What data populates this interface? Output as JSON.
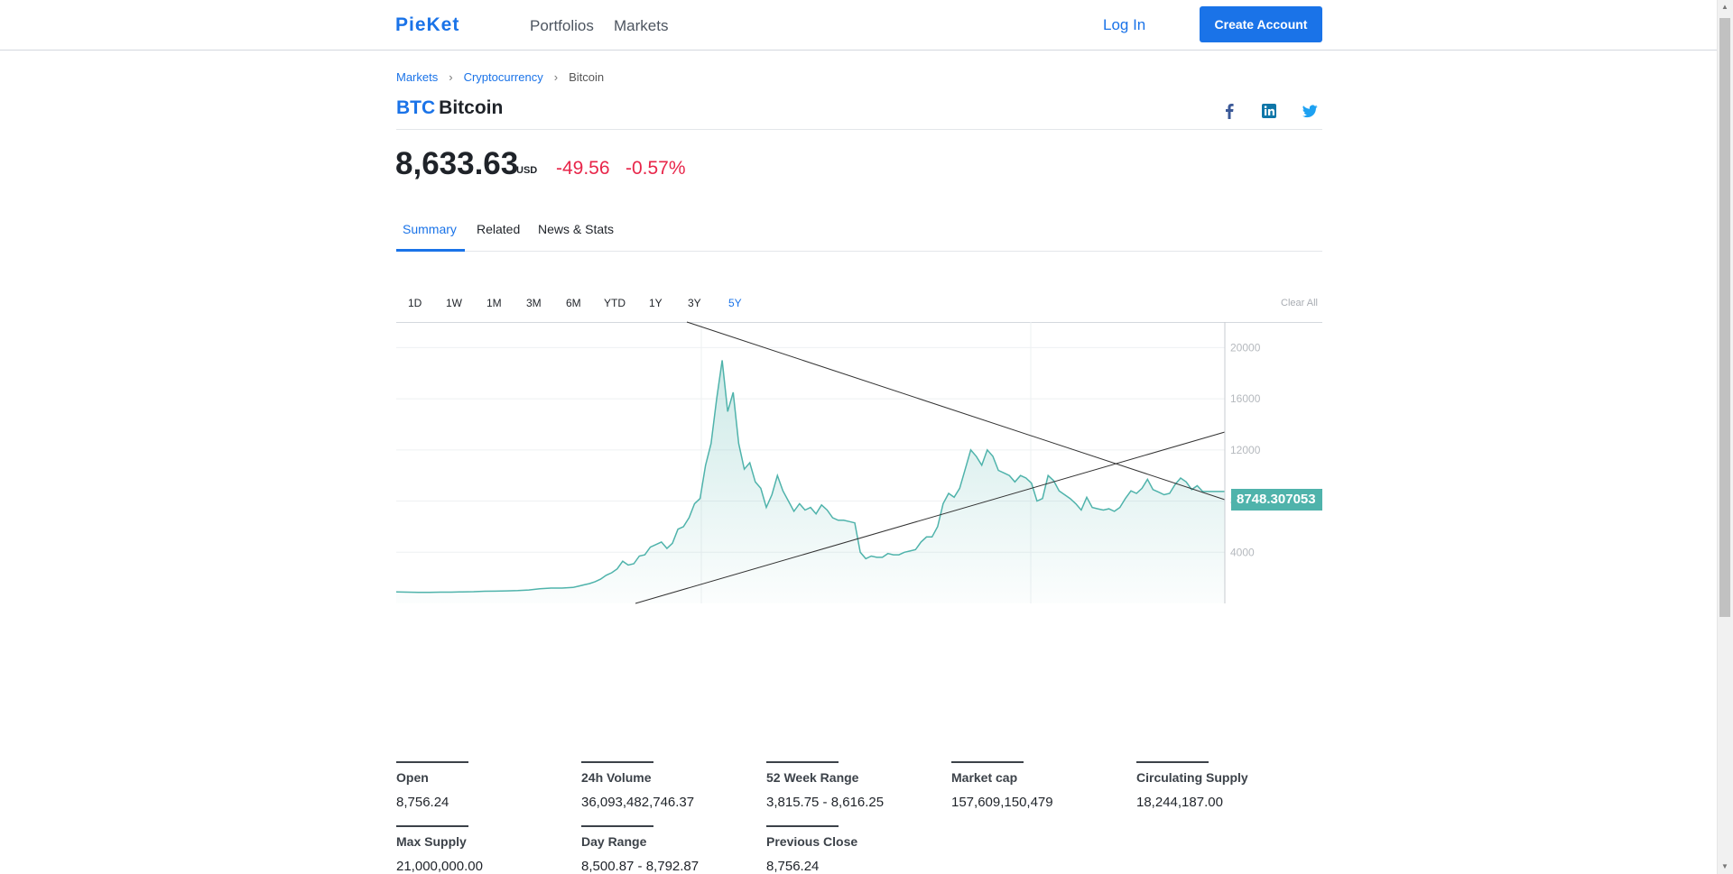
{
  "nav": {
    "logo": "PieKet",
    "links": [
      "Portfolios",
      "Markets"
    ],
    "login": "Log In",
    "create_account": "Create Account"
  },
  "breadcrumb": [
    "Markets",
    "Cryptocurrency",
    "Bitcoin"
  ],
  "asset": {
    "ticker": "BTC",
    "name": "Bitcoin",
    "price": "8,633.63",
    "currency": "USD",
    "change": "-49.56",
    "change_pct": "-0.57%"
  },
  "social": [
    "facebook-icon",
    "linkedin-icon",
    "twitter-icon"
  ],
  "tabs": [
    "Summary",
    "Related",
    "News & Stats"
  ],
  "ranges": [
    "1D",
    "1W",
    "1M",
    "3M",
    "6M",
    "YTD",
    "1Y",
    "3Y",
    "5Y"
  ],
  "active_range": "5Y",
  "clear_all": "Clear All",
  "colors": {
    "accent": "#1a73e8",
    "negative": "#e8264a",
    "chart_line": "#4fb3ab"
  },
  "chart_data": {
    "type": "area",
    "ylim": [
      0,
      22000
    ],
    "y_ticks": [
      4000,
      8000,
      12000,
      16000,
      20000
    ],
    "current_value": "8748.307053",
    "x": [
      0,
      10,
      20,
      30,
      40,
      50,
      60,
      70,
      80,
      90,
      100,
      110,
      120,
      130,
      140,
      150,
      160,
      165,
      170,
      175,
      180,
      185,
      190,
      195,
      200,
      205,
      210,
      215,
      220,
      225,
      230,
      235,
      240,
      245,
      250,
      255,
      260,
      265,
      270,
      275,
      280,
      285,
      290,
      295,
      300,
      305,
      310,
      315,
      320,
      325,
      330,
      335,
      340,
      345,
      350,
      355,
      360,
      365,
      370,
      375,
      380,
      385,
      390,
      395,
      400,
      405,
      410,
      415,
      420,
      425,
      430,
      435,
      440,
      445,
      450,
      455,
      460,
      465,
      470,
      475,
      480,
      485,
      490,
      495,
      500,
      505,
      510,
      515,
      520,
      525,
      530,
      535,
      540,
      545,
      550,
      555,
      560,
      565,
      570,
      575,
      580,
      585,
      590,
      595,
      600,
      605,
      610,
      615,
      620,
      625,
      630,
      635,
      640,
      645,
      650,
      655,
      660,
      665,
      670,
      675,
      680,
      685,
      690,
      695,
      700,
      705,
      710,
      715,
      720,
      725,
      730,
      735,
      740,
      745,
      750
    ],
    "values": [
      900,
      880,
      870,
      860,
      880,
      880,
      900,
      920,
      950,
      960,
      980,
      1000,
      1050,
      1150,
      1200,
      1200,
      1250,
      1350,
      1450,
      1550,
      1700,
      1900,
      2200,
      2400,
      2700,
      3300,
      3000,
      3100,
      3700,
      3800,
      4400,
      4600,
      4800,
      4300,
      4700,
      5800,
      6000,
      6700,
      7800,
      8200,
      10800,
      12500,
      16000,
      19000,
      15000,
      16500,
      12500,
      10500,
      11000,
      9500,
      9000,
      7500,
      8500,
      10000,
      8800,
      8000,
      7200,
      7800,
      7300,
      7500,
      7000,
      7700,
      7300,
      6700,
      6500,
      6500,
      6400,
      6300,
      4000,
      3500,
      3700,
      3600,
      3600,
      3900,
      3800,
      3800,
      4000,
      4100,
      4200,
      4800,
      5200,
      5200,
      6000,
      7800,
      8600,
      8300,
      9000,
      10500,
      12000,
      11500,
      10800,
      12000,
      11500,
      10400,
      10200,
      10000,
      9500,
      10000,
      9800,
      9400,
      8000,
      8200,
      10000,
      9600,
      8800,
      8500,
      8200,
      7800,
      7300,
      8300,
      7500,
      7400,
      7300,
      7400,
      7200,
      7500,
      8200,
      8800,
      8600,
      9000,
      9700,
      8900,
      8700,
      8500,
      8600,
      9300,
      9800,
      9500,
      8900,
      9200,
      8748,
      8748,
      8748,
      8748,
      8748
    ]
  },
  "stats": [
    {
      "label": "Open",
      "value": "8,756.24"
    },
    {
      "label": "24h Volume",
      "value": "36,093,482,746.37"
    },
    {
      "label": "52 Week Range",
      "value": "3,815.75 - 8,616.25"
    },
    {
      "label": "Market cap",
      "value": "157,609,150,479"
    },
    {
      "label": "Circulating Supply",
      "value": "18,244,187.00"
    },
    {
      "label": "Max Supply",
      "value": "21,000,000.00"
    },
    {
      "label": "Day Range",
      "value": "8,500.87 - 8,792.87"
    },
    {
      "label": "Previous Close",
      "value": "8,756.24"
    }
  ]
}
